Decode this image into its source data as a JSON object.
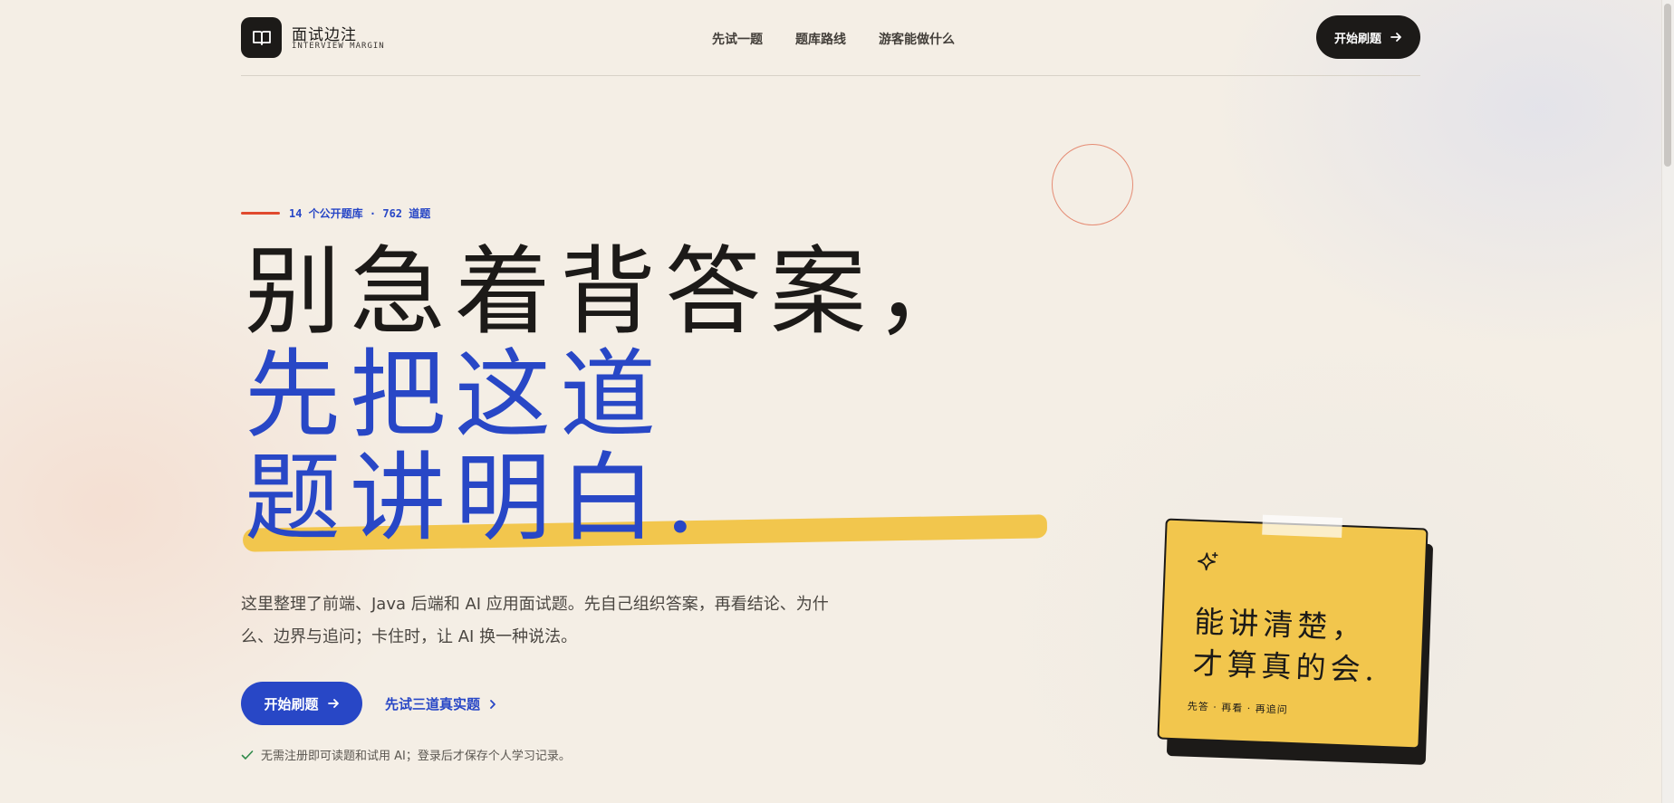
{
  "brand": {
    "name_cn": "面试边注",
    "name_en": "INTERVIEW MARGIN"
  },
  "nav": {
    "items": [
      "先试一题",
      "题库路线",
      "游客能做什么"
    ]
  },
  "header": {
    "cta_label": "开始刷题"
  },
  "hero": {
    "eyebrow": "14 个公开题库 · 762 道题",
    "headline": {
      "line1": "别急着背答案，",
      "line2": "先把这道",
      "line3": "题讲明白."
    },
    "description": "这里整理了前端、Java 后端和 AI 应用面试题。先自己组织答案，再看结论、为什么、边界与追问；卡住时，让 AI 换一种说法。",
    "primary_cta": "开始刷题",
    "secondary_cta": "先试三道真实题",
    "note": "无需注册即可读题和试用 AI；登录后才保存个人学习记录。"
  },
  "card": {
    "title_line1": "能讲清楚，",
    "title_line2": "才算真的会.",
    "meta": "先答 · 再看 · 再追问"
  },
  "colors": {
    "accent_blue": "#2847c6",
    "accent_yellow": "#f2c64d",
    "accent_red": "#e04a2e",
    "dark": "#1c1a18",
    "background": "#f4eee5"
  },
  "icons": {
    "logo": "open-book-icon",
    "arrow": "arrow-right-icon",
    "chevron": "chevron-right-icon",
    "check": "check-icon",
    "sparkle": "sparkle-icon"
  }
}
